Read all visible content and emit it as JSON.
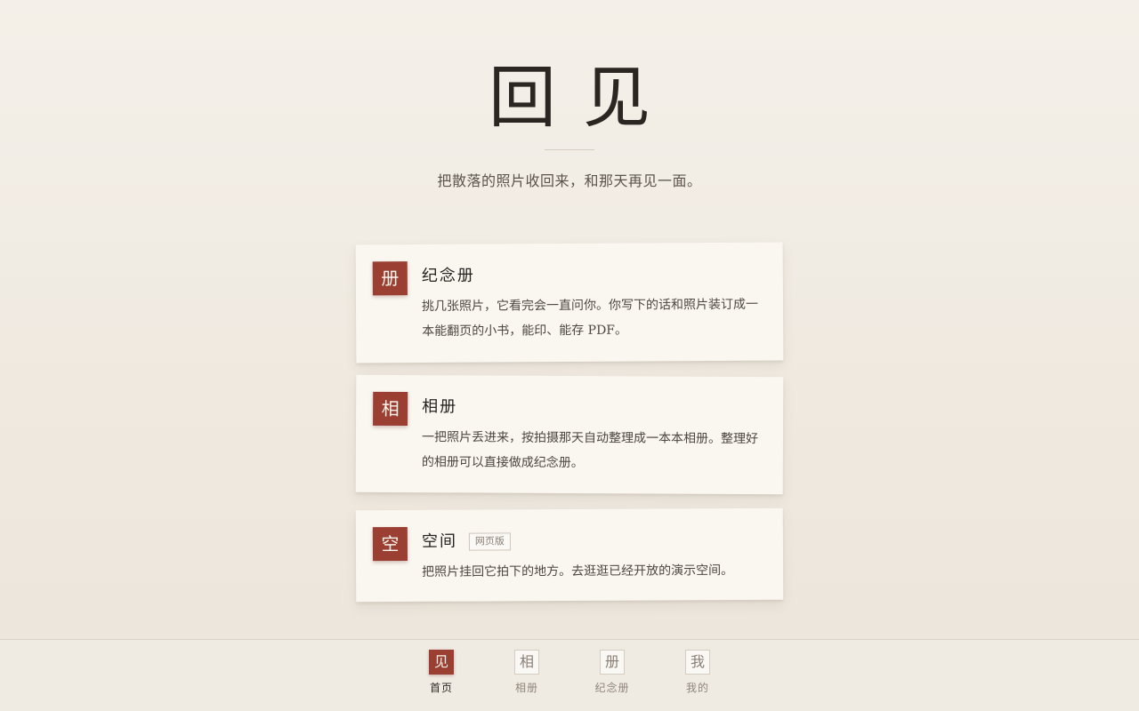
{
  "hero": {
    "title": "回见",
    "tagline": "把散落的照片收回来，和那天再见一面。"
  },
  "cards": [
    {
      "seal": "册",
      "title": "纪念册",
      "description": "挑几张照片，它看完会一直问你。你写下的话和照片装订成一本能翻页的小书，能印、能存 PDF。"
    },
    {
      "seal": "相",
      "title": "相册",
      "description": "一把照片丢进来，按拍摄那天自动整理成一本本相册。整理好的相册可以直接做成纪念册。"
    },
    {
      "seal": "空",
      "title": "空间",
      "badge": "网页版",
      "description": "把照片挂回它拍下的地方。去逛逛已经开放的演示空间。"
    }
  ],
  "nav": {
    "active_index": 0,
    "items": [
      {
        "icon": "见",
        "label": "首页"
      },
      {
        "icon": "相",
        "label": "相册"
      },
      {
        "icon": "册",
        "label": "纪念册"
      },
      {
        "icon": "我",
        "label": "我的"
      }
    ]
  },
  "colors": {
    "accent": "#9a3f32",
    "background": "#f2ede5",
    "card": "#faf7f1",
    "text": "#2b2724"
  }
}
